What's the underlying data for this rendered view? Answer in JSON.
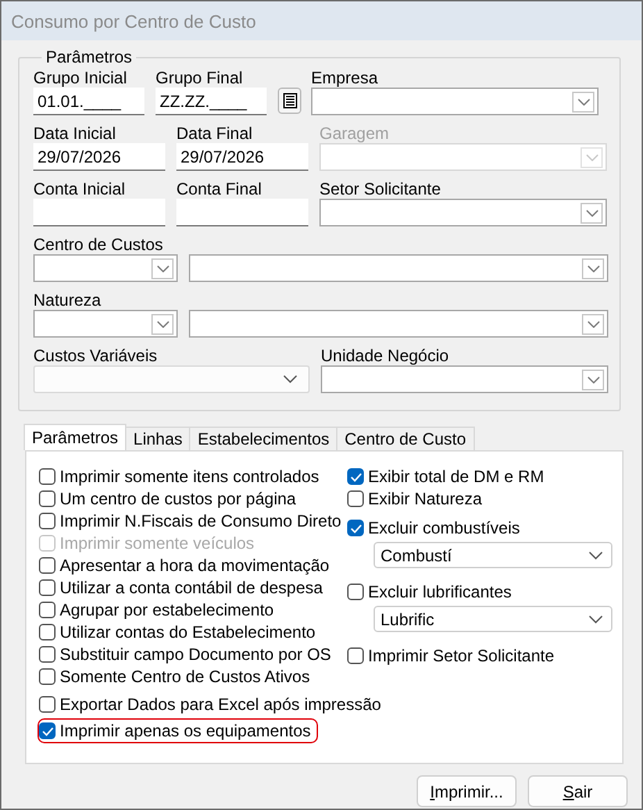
{
  "window": {
    "title": "Consumo por Centro de Custo"
  },
  "parameters": {
    "title": "Parâmetros",
    "fields": [
      {
        "kind": "input",
        "label": "Grupo Inicial",
        "value": "01.01.____"
      },
      {
        "kind": "input",
        "label": "Grupo Final",
        "value": "ZZ.ZZ.____"
      },
      {
        "kind": "button"
      },
      {
        "kind": "combo",
        "label": "Empresa",
        "disabled": false
      },
      {
        "kind": "input",
        "label": "Data Inicial",
        "value": "29/07/2026"
      },
      {
        "kind": "input",
        "label": "Data Final",
        "value": "29/07/2026"
      },
      {
        "kind": "combo",
        "label": "Garagem",
        "disabled": true
      },
      {
        "kind": "input",
        "label": "Conta Inicial"
      },
      {
        "kind": "input",
        "label": "Conta Final"
      },
      {
        "kind": "combo",
        "label": "Setor Solicitante",
        "disabled": false
      },
      {
        "kind": "combo",
        "label": "Centro de Custos",
        "disabled": false
      },
      {
        "kind": "combo",
        "disabled": false
      },
      {
        "kind": "combo",
        "label": "Natureza",
        "disabled": false
      },
      {
        "kind": "combo",
        "disabled": false
      },
      {
        "kind": "dropdown",
        "label": "Custos Variáveis"
      },
      {
        "kind": "combo",
        "label": "Unidade Negócio",
        "disabled": false
      }
    ]
  },
  "tabs": [
    {
      "label": "Parâmetros",
      "selected": true
    },
    {
      "label": "Linhas",
      "selected": false
    },
    {
      "label": "Estabelecimentos",
      "selected": false
    },
    {
      "label": "Centro de Custo",
      "selected": false
    }
  ],
  "left_options": [
    {
      "label": "Imprimir somente itens controlados",
      "checked": false,
      "disabled": false,
      "highlighted": false
    },
    {
      "label": "Um centro de custos por página",
      "checked": false,
      "disabled": false,
      "highlighted": false
    },
    {
      "label": "Imprimir N.Fiscais de Consumo Direto",
      "checked": false,
      "disabled": false,
      "highlighted": false
    },
    {
      "label": "Imprimir somente veículos",
      "checked": false,
      "disabled": true,
      "highlighted": false
    },
    {
      "label": "Apresentar a hora da movimentação",
      "checked": false,
      "disabled": false,
      "highlighted": false
    },
    {
      "label": "Utilizar a conta contábil de despesa",
      "checked": false,
      "disabled": false,
      "highlighted": false
    },
    {
      "label": "Agrupar por estabelecimento",
      "checked": false,
      "disabled": false,
      "highlighted": false
    },
    {
      "label": "Utilizar contas do Estabelecimento",
      "checked": false,
      "disabled": false,
      "highlighted": false
    },
    {
      "label": "Substituir campo Documento por OS",
      "checked": false,
      "disabled": false,
      "highlighted": false
    },
    {
      "label": "Somente Centro de Custos Ativos",
      "checked": false,
      "disabled": false,
      "highlighted": false
    },
    {
      "label": "Exportar Dados para Excel após impressão",
      "checked": false,
      "disabled": false,
      "highlighted": false
    },
    {
      "label": "Imprimir apenas os equipamentos",
      "checked": true,
      "disabled": false,
      "highlighted": true
    }
  ],
  "right_options": [
    {
      "kind": "checkbox",
      "label": "Exibir total de DM e RM",
      "checked": true
    },
    {
      "kind": "checkbox",
      "label": "Exibir Natureza",
      "checked": false
    },
    {
      "kind": "checkbox",
      "label": "Excluir combustíveis",
      "checked": true
    },
    {
      "kind": "dropdown",
      "value": "Combustí"
    },
    {
      "kind": "checkbox",
      "label": "Excluir lubrificantes",
      "checked": false
    },
    {
      "kind": "dropdown",
      "value": "Lubrific"
    },
    {
      "kind": "checkbox",
      "label": "Imprimir Setor Solicitante",
      "checked": false
    }
  ],
  "buttons": [
    "Imprimir...",
    "Sair"
  ]
}
